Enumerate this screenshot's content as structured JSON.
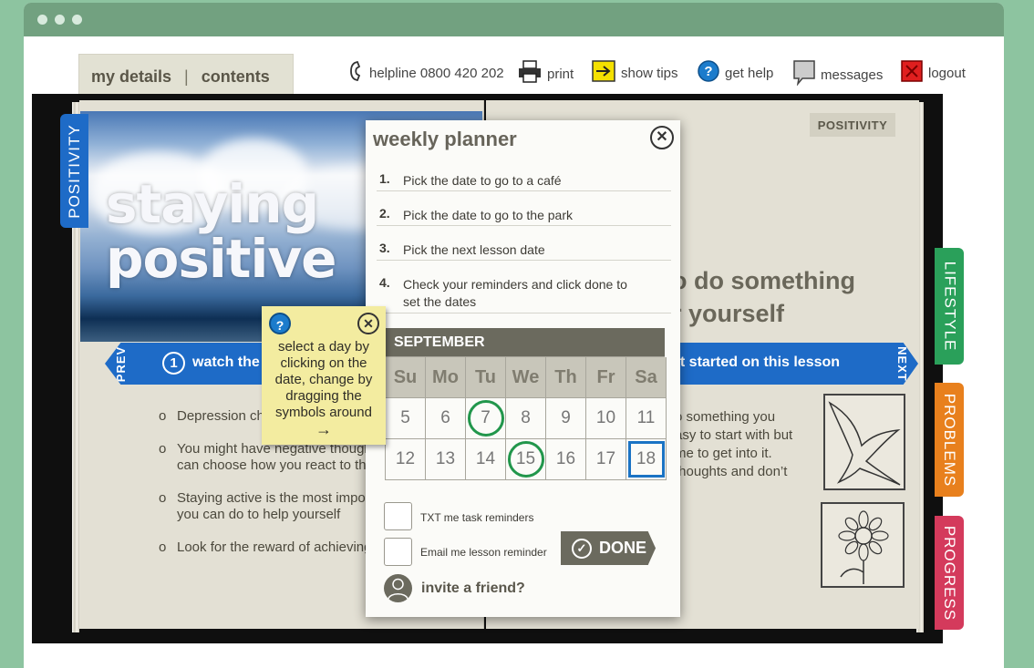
{
  "nav": {
    "my_details": "my details",
    "separator": "|",
    "contents": "contents"
  },
  "toolbar": {
    "helpline": "helpline 0800 420 202",
    "print": "print",
    "show_tips": "show tips",
    "get_help": "get help",
    "messages": "messages",
    "logout": "logout"
  },
  "lesson": {
    "photo_title_1": "staying",
    "photo_title_2": "positive",
    "badge": "POSITIVITY",
    "prev": "PREV",
    "next": "NEXT",
    "step_number": "1",
    "step_left": "watch the",
    "step_right": "et started on this lesson",
    "heading_1": "o do something",
    "heading_2": "r yourself",
    "bullets": [
      {
        "mark": "o",
        "line1": "Depression ch",
        "line2": ""
      },
      {
        "mark": "o",
        "line1": "You might have negative though",
        "line2": "can choose how you react to th"
      },
      {
        "mark": "o",
        "line1": "Staying active is the most impo",
        "line2": "you can do to help yourself"
      },
      {
        "mark": "o",
        "line1": "Look for the reward of achieving",
        "line2": ""
      }
    ],
    "right_lines": [
      "o something you",
      "asy to start with but",
      "me to get into it.",
      " thoughts and don’t"
    ]
  },
  "side_tabs": {
    "positivity": "POSITIVITY",
    "lifestyle": "LIFESTYLE",
    "problems": "PROBLEMS",
    "progress": "PROGRESS"
  },
  "planner": {
    "title": "weekly planner",
    "close": "✕",
    "tasks": [
      {
        "num": "1.",
        "text": "Pick the date to go to a café",
        "text2": ""
      },
      {
        "num": "2.",
        "text": "Pick the date to go to the park",
        "text2": ""
      },
      {
        "num": "3.",
        "text": "Pick the next lesson date",
        "text2": ""
      },
      {
        "num": "4.",
        "text": "Check your reminders and click done to",
        "text2": "set the dates"
      }
    ],
    "calendar": {
      "month": "SEPTEMBER",
      "days": [
        "Su",
        "Mo",
        "Tu",
        "We",
        "Th",
        "Fr",
        "Sa"
      ],
      "week1": [
        "5",
        "6",
        "7",
        "8",
        "9",
        "10",
        "11"
      ],
      "week2": [
        "12",
        "13",
        "14",
        "15",
        "16",
        "17",
        "18"
      ]
    },
    "txt_reminder": "TXT me task reminders",
    "email_reminder": "Email me lesson reminder",
    "done": "DONE",
    "done_check": "✓",
    "invite": "invite a friend?"
  },
  "tip": {
    "help": "?",
    "close": "✕",
    "line1": "select a day by",
    "line2": "clicking on the",
    "line3": "date, change by",
    "line4": "dragging the",
    "line5": "symbols around",
    "arrow": "→"
  },
  "colors": {
    "brand_green": "#72a180",
    "accent_blue": "#1e6bc7",
    "lifestyle": "#2aa05a",
    "problems": "#e8801d",
    "progress": "#d43a5c",
    "highlight_green": "#21964b",
    "highlight_blue": "#1a73c4",
    "tip_yellow": "#f3eca0"
  },
  "icons": {
    "phone": "phone-icon",
    "print": "printer-icon",
    "tips": "arrow-right-icon",
    "help": "question-icon",
    "messages": "message-icon",
    "logout": "close-icon"
  }
}
